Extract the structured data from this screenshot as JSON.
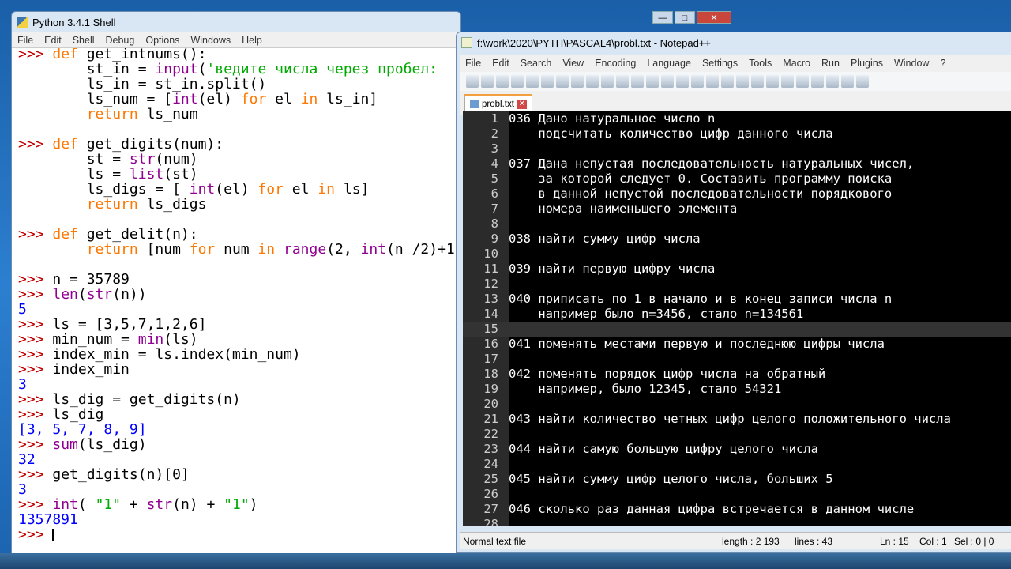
{
  "shell": {
    "title": "Python 3.4.1 Shell",
    "menu": [
      "File",
      "Edit",
      "Shell",
      "Debug",
      "Options",
      "Windows",
      "Help"
    ],
    "lines": [
      [
        [
          ">>> ",
          "pr"
        ],
        [
          "def ",
          "kw"
        ],
        [
          "get_intnums():",
          ""
        ]
      ],
      [
        [
          "        st_in = ",
          ""
        ],
        [
          "input",
          "bi"
        ],
        [
          "(",
          ""
        ],
        [
          "'ведите числа через пробел:",
          "st"
        ]
      ],
      [
        [
          "        ls_in = st_in.split()",
          ""
        ]
      ],
      [
        [
          "        ls_num = [",
          ""
        ],
        [
          "int",
          "bi"
        ],
        [
          "(el) ",
          ""
        ],
        [
          "for",
          "kw"
        ],
        [
          " el ",
          ""
        ],
        [
          "in",
          "kw"
        ],
        [
          " ls_in]",
          ""
        ]
      ],
      [
        [
          "        ",
          ""
        ],
        [
          "return",
          "kw"
        ],
        [
          " ls_num",
          ""
        ]
      ],
      [],
      [
        [
          ">>> ",
          "pr"
        ],
        [
          "def ",
          "kw"
        ],
        [
          "get_digits(num):",
          ""
        ]
      ],
      [
        [
          "        st = ",
          ""
        ],
        [
          "str",
          "bi"
        ],
        [
          "(num)",
          ""
        ]
      ],
      [
        [
          "        ls = ",
          ""
        ],
        [
          "list",
          "bi"
        ],
        [
          "(st)",
          ""
        ]
      ],
      [
        [
          "        ls_digs = [ ",
          ""
        ],
        [
          "int",
          "bi"
        ],
        [
          "(el) ",
          ""
        ],
        [
          "for",
          "kw"
        ],
        [
          " el ",
          ""
        ],
        [
          "in",
          "kw"
        ],
        [
          " ls]",
          ""
        ]
      ],
      [
        [
          "        ",
          ""
        ],
        [
          "return",
          "kw"
        ],
        [
          " ls_digs",
          ""
        ]
      ],
      [],
      [
        [
          ">>> ",
          "pr"
        ],
        [
          "def ",
          "kw"
        ],
        [
          "get_delit(n):",
          ""
        ]
      ],
      [
        [
          "        ",
          ""
        ],
        [
          "return",
          "kw"
        ],
        [
          " [num ",
          ""
        ],
        [
          "for",
          "kw"
        ],
        [
          " num ",
          ""
        ],
        [
          "in",
          "kw"
        ],
        [
          " ",
          ""
        ],
        [
          "range",
          "bi"
        ],
        [
          "(2, ",
          ""
        ],
        [
          "int",
          "bi"
        ],
        [
          "(n /2)+1",
          ""
        ]
      ],
      [],
      [
        [
          ">>> ",
          "pr"
        ],
        [
          "n = 35789",
          ""
        ]
      ],
      [
        [
          ">>> ",
          "pr"
        ],
        [
          "len",
          "bi"
        ],
        [
          "(",
          ""
        ],
        [
          "str",
          "bi"
        ],
        [
          "(n))",
          ""
        ]
      ],
      [
        [
          "5",
          "out"
        ]
      ],
      [
        [
          ">>> ",
          "pr"
        ],
        [
          "ls = [3,5,7,1,2,6]",
          ""
        ]
      ],
      [
        [
          ">>> ",
          "pr"
        ],
        [
          "min_num = ",
          ""
        ],
        [
          "min",
          "bi"
        ],
        [
          "(ls)",
          ""
        ]
      ],
      [
        [
          ">>> ",
          "pr"
        ],
        [
          "index_min = ls.index(min_num)",
          ""
        ]
      ],
      [
        [
          ">>> ",
          "pr"
        ],
        [
          "index_min",
          ""
        ]
      ],
      [
        [
          "3",
          "out"
        ]
      ],
      [
        [
          ">>> ",
          "pr"
        ],
        [
          "ls_dig = get_digits(n)",
          ""
        ]
      ],
      [
        [
          ">>> ",
          "pr"
        ],
        [
          "ls_dig",
          ""
        ]
      ],
      [
        [
          "[3, 5, 7, 8, 9]",
          "out"
        ]
      ],
      [
        [
          ">>> ",
          "pr"
        ],
        [
          "sum",
          "bi"
        ],
        [
          "(ls_dig)",
          ""
        ]
      ],
      [
        [
          "32",
          "out"
        ]
      ],
      [
        [
          ">>> ",
          "pr"
        ],
        [
          "get_digits(n)[0]",
          ""
        ]
      ],
      [
        [
          "3",
          "out"
        ]
      ],
      [
        [
          ">>> ",
          "pr"
        ],
        [
          "int",
          "bi"
        ],
        [
          "( ",
          ""
        ],
        [
          "\"1\"",
          "st"
        ],
        [
          " + ",
          ""
        ],
        [
          "str",
          "bi"
        ],
        [
          "(n) + ",
          ""
        ],
        [
          "\"1\"",
          "st"
        ],
        [
          ")",
          ""
        ]
      ],
      [
        [
          "1357891",
          "out"
        ]
      ],
      [
        [
          ">>> ",
          "pr"
        ]
      ]
    ]
  },
  "notepad": {
    "title": "f:\\work\\2020\\PYTH\\PASCAL4\\probl.txt - Notepad++",
    "menu": [
      "File",
      "Edit",
      "Search",
      "View",
      "Encoding",
      "Language",
      "Settings",
      "Tools",
      "Macro",
      "Run",
      "Plugins",
      "Window",
      "?"
    ],
    "tab": "probl.txt",
    "current_line": 15,
    "lines": [
      "036 Дано натуральное число n",
      "    подсчитать количество цифр данного числа",
      "",
      "037 Дана непустая последовательность натуральных чисел,",
      "    за которой следует 0. Составить программу поиска",
      "    в данной непустой последовательности порядкового",
      "    номера наименьшего элемента",
      "",
      "038 найти сумму цифр числа",
      "",
      "039 найти первую цифру числа",
      "",
      "040 приписать по 1 в начало и в конец записи числа n",
      "    например было n=3456, стало n=134561",
      "",
      "041 поменять местами первую и последнюю цифры числа",
      "",
      "042 поменять порядок цифр числа на обратный",
      "    например, было 12345, стало 54321",
      "",
      "043 найти количество четных цифр целого положительного числа",
      "",
      "044 найти самую большую цифру целого числа",
      "",
      "045 найти сумму цифр целого числа, больших 5",
      "",
      "046 сколько раз данная цифра встречается в данном числе",
      ""
    ],
    "status": {
      "type": "Normal text file",
      "length": "length : 2 193",
      "lines": "lines : 43",
      "ln": "Ln : 15",
      "col": "Col : 1",
      "sel": "Sel : 0 | 0"
    }
  }
}
